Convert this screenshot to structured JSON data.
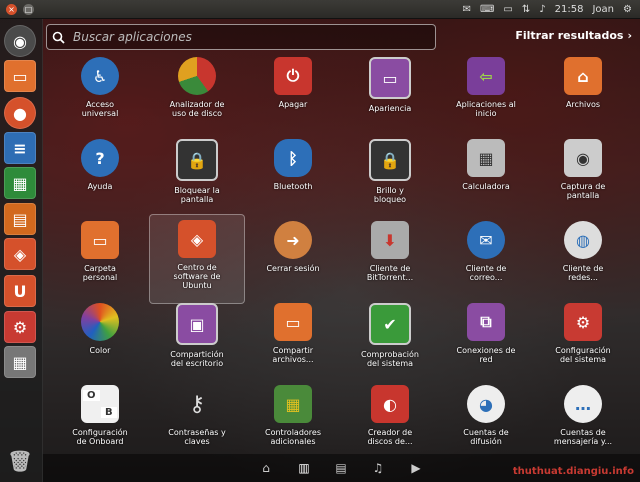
{
  "top_panel": {
    "tray_icons": [
      "mail-icon",
      "keyboard-icon",
      "battery-icon",
      "network-icon",
      "volume-icon"
    ],
    "clock": "21:58",
    "user": "Joan"
  },
  "launcher": {
    "items": [
      {
        "name": "ubuntu-logo",
        "color": "#5a5a5a"
      },
      {
        "name": "files",
        "color": "#e06b2b"
      },
      {
        "name": "firefox",
        "color": "#d5512b"
      },
      {
        "name": "writer",
        "color": "#2e6db4"
      },
      {
        "name": "calc",
        "color": "#2e8b3a"
      },
      {
        "name": "impress",
        "color": "#d2691e"
      },
      {
        "name": "software-center",
        "color": "#d5512b"
      },
      {
        "name": "ubuntu-one",
        "color": "#d5512b"
      },
      {
        "name": "settings",
        "color": "#c83a32"
      },
      {
        "name": "workspaces",
        "color": "#777777"
      },
      {
        "name": "trash",
        "color": "#555555"
      }
    ]
  },
  "search": {
    "placeholder": "Buscar aplicaciones"
  },
  "filter": {
    "label": "Filtrar resultados"
  },
  "apps": [
    {
      "label": "Acceso\nuniversal",
      "icon": "accessibility-icon",
      "color": "#2d6fb8"
    },
    {
      "label": "Analizador de\nuso de disco",
      "icon": "disk-usage-icon",
      "color": "#c8362e"
    },
    {
      "label": "Apagar",
      "icon": "power-icon",
      "color": "#c8362e"
    },
    {
      "label": "Apariencia",
      "icon": "appearance-icon",
      "color": "#8a4ca2"
    },
    {
      "label": "Aplicaciones al\ninicio",
      "icon": "startup-apps-icon",
      "color": "#7a3e9a"
    },
    {
      "label": "Archivos",
      "icon": "home-folder-icon",
      "color": "#e0702e"
    },
    {
      "label": "Ayuda",
      "icon": "help-icon",
      "color": "#2d6fb8"
    },
    {
      "label": "Bloquear la\npantalla",
      "icon": "lock-screen-icon",
      "color": "#444444"
    },
    {
      "label": "Bluetooth",
      "icon": "bluetooth-icon",
      "color": "#2d6fb8"
    },
    {
      "label": "Brillo y\nbloqueo",
      "icon": "brightness-lock-icon",
      "color": "#444444"
    },
    {
      "label": "Calculadora",
      "icon": "calculator-icon",
      "color": "#666666"
    },
    {
      "label": "Captura de\npantalla",
      "icon": "screenshot-icon",
      "color": "#999999"
    },
    {
      "label": "Carpeta\npersonal",
      "icon": "folder-icon",
      "color": "#e0702e"
    },
    {
      "label": "Centro de\nsoftware de\nUbuntu",
      "icon": "software-center-icon",
      "color": "#d5512b"
    },
    {
      "label": "Cerrar sesión",
      "icon": "logout-icon",
      "color": "#d08040"
    },
    {
      "label": "Cliente de\nBitTorrent...",
      "icon": "torrent-icon",
      "color": "#999999"
    },
    {
      "label": "Cliente de\ncorreo...",
      "icon": "mail-client-icon",
      "color": "#2d6fb8"
    },
    {
      "label": "Cliente de\nredes...",
      "icon": "network-client-icon",
      "color": "#aaaaaa"
    },
    {
      "label": "Color",
      "icon": "color-icon",
      "color": "#e05020"
    },
    {
      "label": "Compartición\ndel escritorio",
      "icon": "desktop-sharing-icon",
      "color": "#8a4ca2"
    },
    {
      "label": "Compartir\narchivos...",
      "icon": "file-sharing-icon",
      "color": "#e0702e"
    },
    {
      "label": "Comprobación\ndel sistema",
      "icon": "system-check-icon",
      "color": "#3a9a3a"
    },
    {
      "label": "Conexiones de\nred",
      "icon": "network-connections-icon",
      "color": "#8a4ca2"
    },
    {
      "label": "Configuración\ndel sistema",
      "icon": "system-settings-icon",
      "color": "#c83a32"
    },
    {
      "label": "Configuración\nde Onboard",
      "icon": "onboard-icon",
      "color": "#f0f0f0"
    },
    {
      "label": "Contraseñas y\nclaves",
      "icon": "keys-icon",
      "color": "#888888"
    },
    {
      "label": "Controladores\nadicionales",
      "icon": "drivers-icon",
      "color": "#4a8a3a"
    },
    {
      "label": "Creador de\ndiscos de...",
      "icon": "disk-creator-icon",
      "color": "#c8362e"
    },
    {
      "label": "Cuentas de\ndifusión",
      "icon": "broadcast-accounts-icon",
      "color": "#2d6fb8"
    },
    {
      "label": "Cuentas de\nmensajería y...",
      "icon": "messaging-accounts-icon",
      "color": "#2d6fb8"
    }
  ],
  "lenses": [
    {
      "name": "home-lens-icon",
      "glyph": "⌂"
    },
    {
      "name": "applications-lens-icon",
      "glyph": "▥"
    },
    {
      "name": "files-lens-icon",
      "glyph": "▤"
    },
    {
      "name": "music-lens-icon",
      "glyph": "♫"
    },
    {
      "name": "video-lens-icon",
      "glyph": "▶"
    }
  ],
  "watermark": "thuthuat.diangiu.info"
}
